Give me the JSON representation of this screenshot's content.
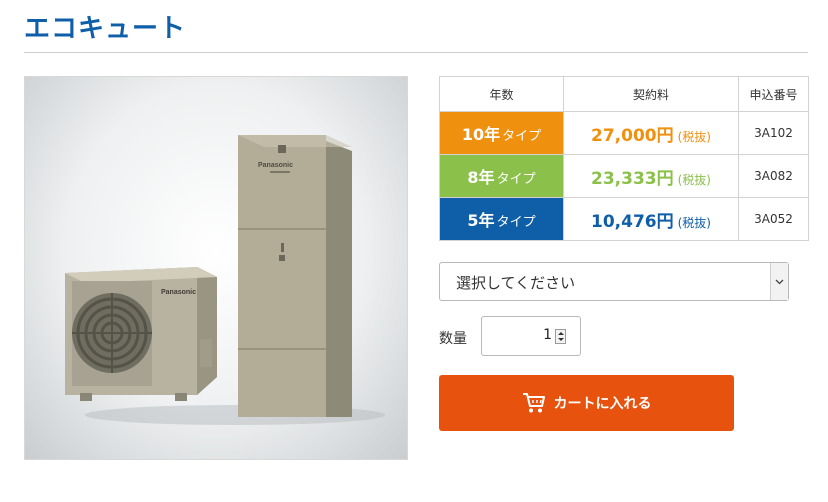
{
  "page": {
    "title": "エコキュート"
  },
  "product_image": {
    "brand_text": "Panasonic"
  },
  "table": {
    "headers": {
      "years": "年数",
      "fee": "契約料",
      "code": "申込番号"
    },
    "rows": [
      {
        "years": "10年",
        "type_suffix": "タイプ",
        "price": "27,000円",
        "tax": "(税抜)",
        "code": "3A102",
        "color": "#f0900f"
      },
      {
        "years": "8年",
        "type_suffix": "タイプ",
        "price": "23,333円",
        "tax": "(税抜)",
        "code": "3A082",
        "color": "#8bc14a"
      },
      {
        "years": "5年",
        "type_suffix": "タイプ",
        "price": "10,476円",
        "tax": "(税抜)",
        "code": "3A052",
        "color": "#0f5ea8"
      }
    ]
  },
  "select": {
    "value": "選択してください"
  },
  "quantity": {
    "label": "数量",
    "value": "1"
  },
  "cart": {
    "label": "カートに入れる"
  }
}
